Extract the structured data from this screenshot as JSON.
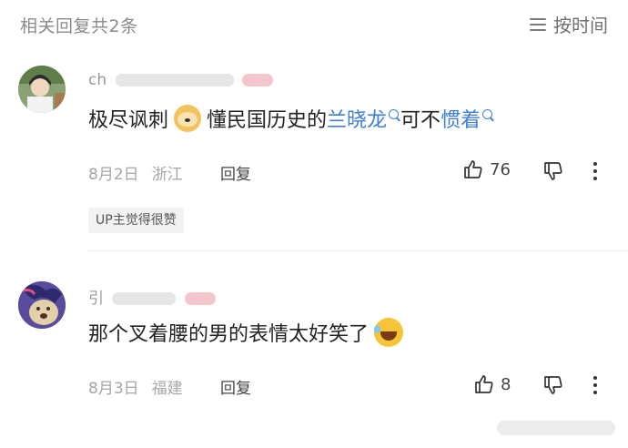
{
  "header": {
    "title": "相关回复共2条",
    "sort_label": "按时间",
    "sort_icon": "menu-lines-icon"
  },
  "comments": [
    {
      "username": "ch",
      "avatar_icon": "user-avatar-photo",
      "text_parts": {
        "a": "极尽讽刺",
        "b": "懂民国历史的",
        "kw1": "兰晓龙",
        "c": "可不",
        "kw2": "惯着"
      },
      "emoji": "dog-emoji-icon",
      "date": "8月2日",
      "location": "浙江",
      "reply_label": "回复",
      "likes": "76",
      "badge": "UP主觉得很赞"
    },
    {
      "username": "引",
      "avatar_icon": "pony-avatar",
      "text_parts": {
        "a": "那个叉着腰的男的表情太好笑了"
      },
      "emoji": "laugh-cry-emoji-icon",
      "date": "8月3日",
      "location": "福建",
      "reply_label": "回复",
      "likes": "8"
    }
  ],
  "colors": {
    "keyword": "#3f7fd6",
    "muted": "#a6a6a6",
    "badge_bg": "#f2f2f2"
  }
}
